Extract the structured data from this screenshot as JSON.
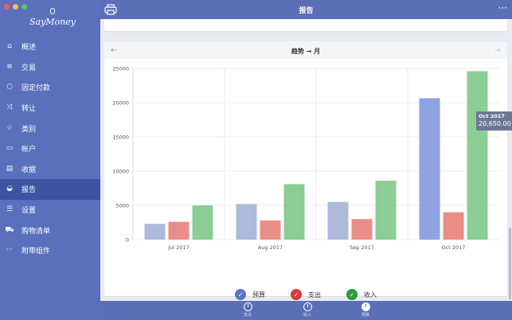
{
  "app": {
    "logo_text": "SayMoney"
  },
  "sidebar": {
    "items": [
      {
        "label": "概述",
        "icon": "house-icon"
      },
      {
        "label": "交易",
        "icon": "list-icon"
      },
      {
        "label": "固定付款",
        "icon": "circle-icon"
      },
      {
        "label": "转让",
        "icon": "shuffle-icon"
      },
      {
        "label": "类别",
        "icon": "star-icon"
      },
      {
        "label": "帐户",
        "icon": "book-icon"
      },
      {
        "label": "收据",
        "icon": "receipt-icon"
      },
      {
        "label": "报告",
        "icon": "pie-icon",
        "active": true
      },
      {
        "label": "设置",
        "icon": "sliders-icon"
      },
      {
        "label": "购物清单",
        "icon": "cart-icon"
      },
      {
        "label": "附带组件",
        "icon": "ellipsis-icon"
      }
    ]
  },
  "header": {
    "title": "报告",
    "more": "···"
  },
  "card": {
    "title": "趋势 → 月",
    "prev_arrow": "←",
    "next_arrow": "→"
  },
  "tooltip": {
    "date": "Oct 2017",
    "value": "20,650.00 ¥"
  },
  "legend": [
    {
      "label": "预算",
      "color": "#5b73c6",
      "check": "✓"
    },
    {
      "label": "支出",
      "color": "#d93a36",
      "check": "✓"
    },
    {
      "label": "收入",
      "color": "#2e9a3e",
      "check": "✓"
    }
  ],
  "chart_data": {
    "type": "bar",
    "categories": [
      "Jul 2017",
      "Aug 2017",
      "Sep 2017",
      "Oct 2017"
    ],
    "series": [
      {
        "name": "预算",
        "values": [
          2300,
          5200,
          5500,
          20650
        ],
        "color": "#aebadc"
      },
      {
        "name": "支出",
        "values": [
          2600,
          2800,
          3000,
          4000
        ],
        "color": "#e98d88"
      },
      {
        "name": "收入",
        "values": [
          5000,
          8100,
          8600,
          24600
        ],
        "color": "#8ccc95"
      }
    ],
    "highlight": {
      "series": 0,
      "category": 3,
      "color": "#8fa3e2"
    },
    "yticks": [
      "0",
      "5000",
      "10000",
      "15000",
      "20000",
      "25000"
    ],
    "ylim": [
      0,
      25000
    ]
  },
  "bottom_tabs": [
    {
      "label": "支出"
    },
    {
      "label": "收入"
    },
    {
      "label": "预算",
      "active": true
    }
  ]
}
